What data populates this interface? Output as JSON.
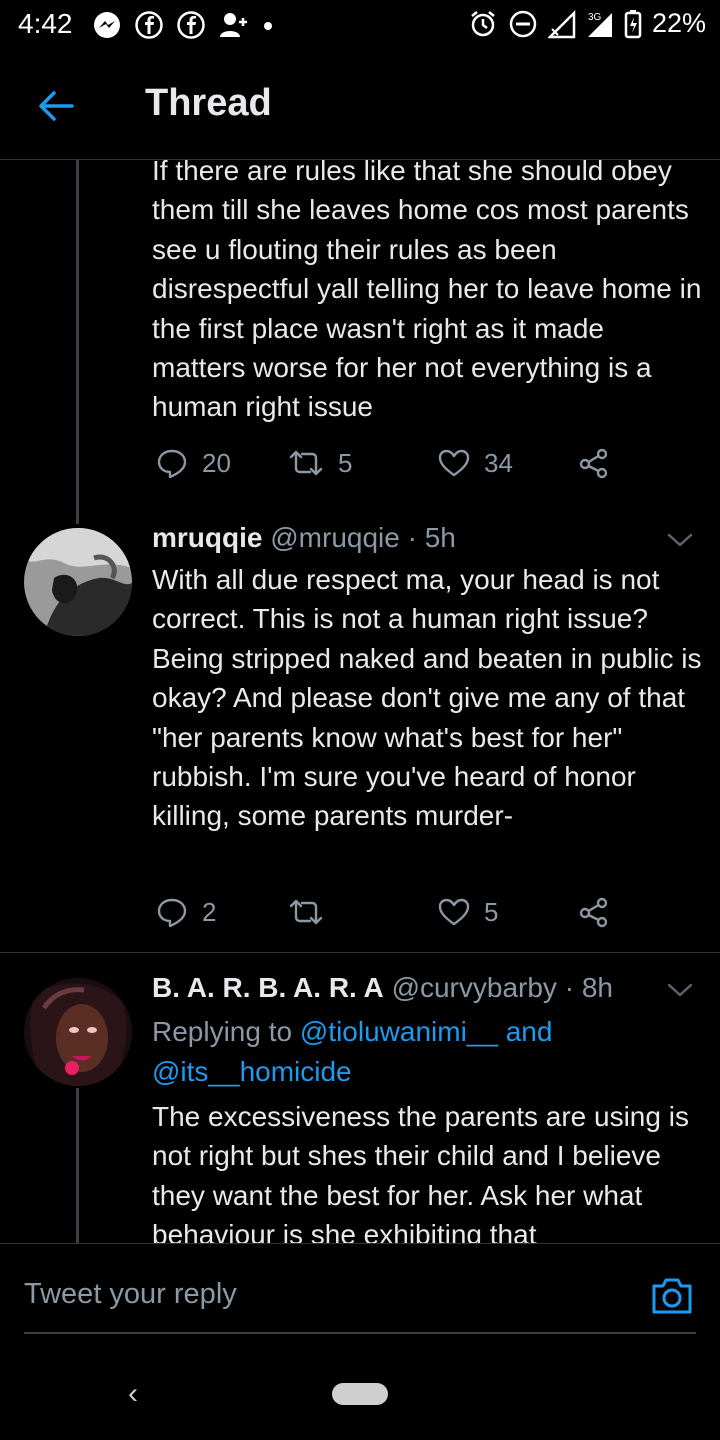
{
  "status_bar": {
    "time": "4:42",
    "battery": "22%",
    "network": "3G",
    "icons_left": [
      "messenger-icon",
      "facebook-icon",
      "facebook-icon",
      "add-user-icon",
      "dot-icon"
    ],
    "icons_right": [
      "alarm-icon",
      "dnd-icon",
      "signal-icon",
      "signal-icon",
      "battery-icon"
    ]
  },
  "header": {
    "title": "Thread",
    "back_icon": "arrow-left-icon",
    "accent": "#1d9bf0"
  },
  "tweets": [
    {
      "text": "If there are rules like that she should obey them till she leaves home cos most parents see u flouting their rules as been disrespectful  yall telling her to leave home in the first place wasn't right as it made matters worse for her not everything is a human right issue",
      "replies": "20",
      "retweets": "5",
      "likes": "34"
    },
    {
      "name": "mruqqie",
      "handle": "@mruqqie",
      "time": "· 5h",
      "text": "With all due respect ma, your head is not correct. This is not a human right issue? Being stripped naked and beaten in public is okay? And please don't give me any of that \"her parents know what's best for her\" rubbish. I'm sure you've heard of honor killing, some parents murder-",
      "replies": "2",
      "retweets": "",
      "likes": "5"
    },
    {
      "name": "B. A. R. B. A. R. A",
      "handle": "@curvybarby",
      "time": "· 8h",
      "replying_prefix": "Replying to",
      "replying_user1": "@tioluwanimi__",
      "replying_and": "and",
      "replying_user2": "@its__homicide",
      "text": "The excessiveness the parents are using is not right but shes their child and I believe they want the best for her. Ask her what behaviour is she exhibiting that"
    }
  ],
  "reply_bar": {
    "placeholder": "Tweet your reply",
    "camera_icon": "camera-icon"
  },
  "nav_bar": {
    "back_glyph": "‹"
  }
}
